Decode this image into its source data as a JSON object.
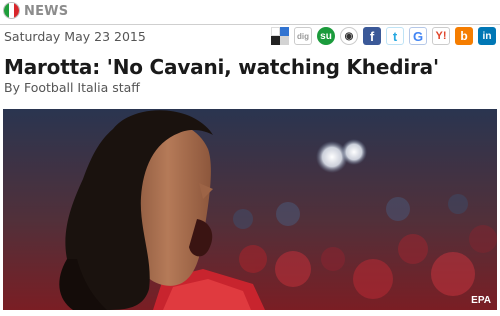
{
  "section": {
    "title": "NEWS",
    "flag_colors": [
      "#1f9d3a",
      "#ffffff",
      "#d8262b"
    ]
  },
  "article": {
    "date": "Saturday May 23 2015",
    "headline": "Marotta: 'No Cavani, watching Khedira'",
    "byline": "By Football Italia staff",
    "photo_credit": "EPA"
  },
  "share_icons": [
    {
      "name": "delicious-icon",
      "glyph": ""
    },
    {
      "name": "digg-icon",
      "glyph": "dig"
    },
    {
      "name": "stumbleupon-icon",
      "glyph": "su"
    },
    {
      "name": "reddit-icon",
      "glyph": "◉"
    },
    {
      "name": "facebook-icon",
      "glyph": "f"
    },
    {
      "name": "twitter-icon",
      "glyph": "t"
    },
    {
      "name": "google-icon",
      "glyph": "G"
    },
    {
      "name": "yahoo-icon",
      "glyph": "Y!"
    },
    {
      "name": "blogger-icon",
      "glyph": "b"
    },
    {
      "name": "linkedin-icon",
      "glyph": "in"
    }
  ]
}
